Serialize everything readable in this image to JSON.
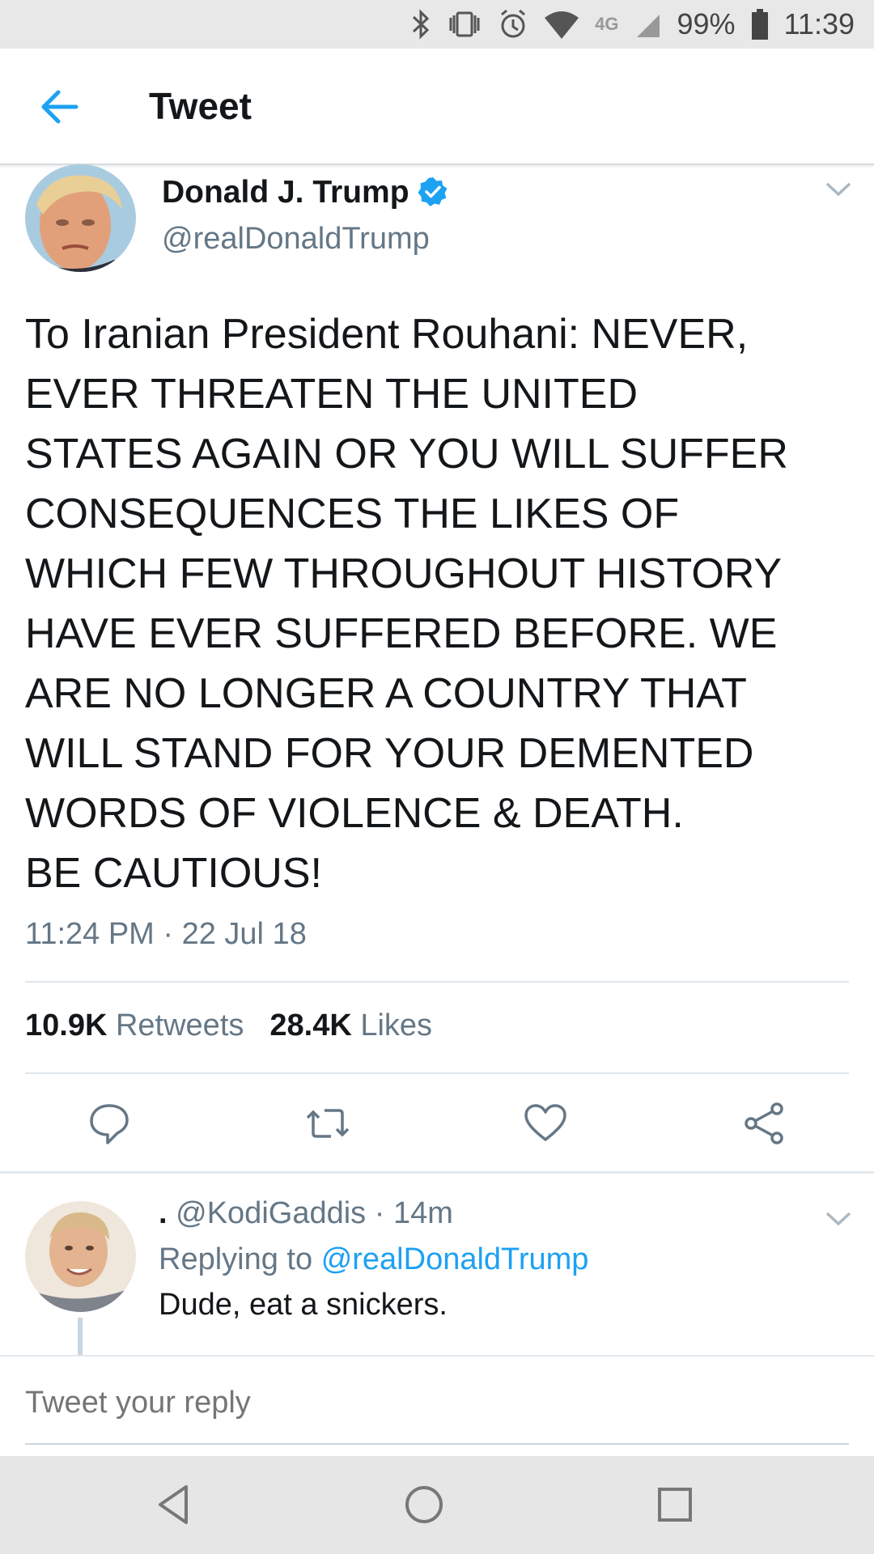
{
  "status_bar": {
    "network": "4G",
    "battery": "99%",
    "time": "11:39"
  },
  "header": {
    "title": "Tweet"
  },
  "tweet": {
    "author_name": "Donald J. Trump",
    "handle": "@realDonaldTrump",
    "lines": [
      "To Iranian President Rouhani: NEVER,",
      "EVER THREATEN THE UNITED",
      "STATES AGAIN OR YOU WILL SUFFER",
      "CONSEQUENCES THE LIKES OF",
      "WHICH FEW THROUGHOUT HISTORY",
      "HAVE EVER SUFFERED BEFORE. WE",
      "ARE NO LONGER A COUNTRY THAT",
      "WILL STAND FOR YOUR DEMENTED",
      "WORDS OF VIOLENCE & DEATH.",
      "BE CAUTIOUS!"
    ],
    "timestamp": "11:24 PM · 22 Jul 18",
    "retweets_count": "10.9K",
    "retweets_label": "Retweets",
    "likes_count": "28.4K",
    "likes_label": "Likes"
  },
  "reply": {
    "name": ".",
    "handle": "@KodiGaddis",
    "time": "· 14m",
    "replying_label": "Replying to",
    "replying_to": "@realDonaldTrump",
    "text": "Dude, eat a snickers."
  },
  "composer": {
    "placeholder": "Tweet your reply"
  },
  "colors": {
    "accent": "#1da1f2",
    "secondary_text": "#657786",
    "divider": "#e1e8ed"
  }
}
